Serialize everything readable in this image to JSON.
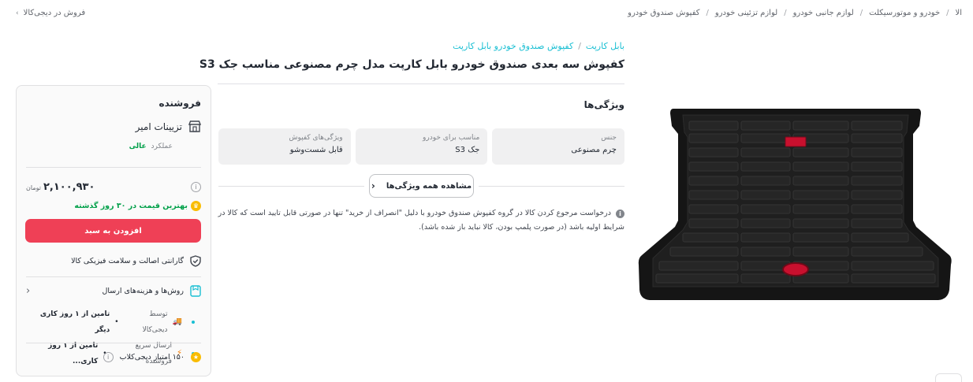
{
  "topbar": {
    "breadcrumb": [
      "الا",
      "خودرو و موتورسیکلت",
      "لوازم جانبی خودرو",
      "لوازم تزئینی خودرو",
      "کفپوش صندوق خودرو"
    ],
    "sell_link": "فروش در دیجی‌کالا"
  },
  "product": {
    "brand_crumb": [
      "بابل کارپت",
      "کفپوش صندوق خودرو بابل کارپت"
    ],
    "title": "کفپوش سه بعدی صندوق خودرو بابل کارپت مدل چرم مصنوعی مناسب جک S3",
    "features_title": "ویژگی‌ها",
    "attributes": [
      {
        "key": "جنس",
        "value": "چرم مصنوعی"
      },
      {
        "key": "مناسب برای خودرو",
        "value": "جک S3"
      },
      {
        "key": "ویژگی‌های کفپوش",
        "value": "قابل شست‌وشو"
      }
    ],
    "see_all_label": "مشاهده همه ویژگی‌ها",
    "return_note": "درخواست مرجوع کردن کالا در گروه کفپوش صندوق خودرو با دلیل \"انصراف از خرید\" تنها در صورتی قابل تایید است که کالا در شرایط اولیه باشد (در صورت پلمپ بودن، کالا نباید باز شده باشد)."
  },
  "seller": {
    "title": "فروشنده",
    "shop_name": "تزیینات امیر",
    "performance_label": "عملکرد",
    "performance_value": "عالی",
    "price": "۲,۱۰۰,۹۳۰",
    "currency": "تومان",
    "best_price_text": "بهترین قیمت در ۳۰ روز گذشته",
    "add_to_cart": "افزودن به سبد",
    "guarantee": "گارانتی اصالت و سلامت فیزیکی کالا",
    "shipping_title": "روش‌ها و هزینه‌های ارسال",
    "shipping_options": [
      {
        "label": "توسط دیجی‌کالا",
        "detail": "تامین از ۱ روز کاری دیگر"
      },
      {
        "label": "ارسال سریع فروشنده",
        "detail": "تامین از ۱ روز کاری..."
      }
    ],
    "club_points": "۱۵۰ امتیاز دیجی‌کلاب"
  },
  "colors": {
    "accent": "#19bfd3",
    "cta": "#ef4056",
    "success": "#00a049"
  }
}
